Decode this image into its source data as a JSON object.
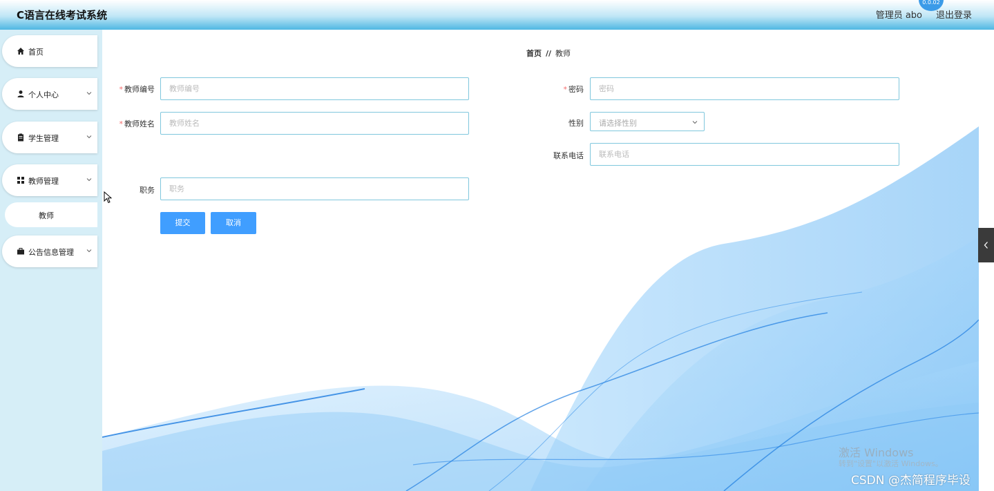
{
  "header": {
    "app_title": "C语言在线考试系统",
    "user_label": "管理员 abo",
    "logout_label": "退出登录",
    "avatar_text": "0.0.02"
  },
  "sidebar": {
    "items": [
      {
        "label": "首页",
        "icon": "home-icon"
      },
      {
        "label": "个人中心",
        "icon": "user-icon"
      },
      {
        "label": "学生管理",
        "icon": "clipboard-icon"
      },
      {
        "label": "教师管理",
        "icon": "grid-icon"
      },
      {
        "label": "公告信息管理",
        "icon": "briefcase-icon"
      }
    ],
    "sub_item": "教师"
  },
  "breadcrumb": {
    "home": "首页",
    "separator": "//",
    "current": "教师"
  },
  "form": {
    "teacher_id": {
      "label": "教师编号",
      "placeholder": "教师编号",
      "required": true
    },
    "password": {
      "label": "密码",
      "placeholder": "密码",
      "required": true
    },
    "teacher_name": {
      "label": "教师姓名",
      "placeholder": "教师姓名",
      "required": true
    },
    "gender": {
      "label": "性别",
      "placeholder": "请选择性别"
    },
    "phone": {
      "label": "联系电话",
      "placeholder": "联系电话"
    },
    "position": {
      "label": "职务",
      "placeholder": "职务"
    },
    "required_mark": "*",
    "submit_label": "提交",
    "cancel_label": "取消"
  },
  "overlay": {
    "activate_title": "激活 Windows",
    "activate_sub": "转到\"设置\"以激活 Windows。",
    "csdn_mark": "CSDN @杰简程序毕设"
  },
  "colors": {
    "primary": "#409eff",
    "border": "#7fc7dd",
    "required": "#f56c6c",
    "sidebar_bg": "#d6eef7"
  }
}
